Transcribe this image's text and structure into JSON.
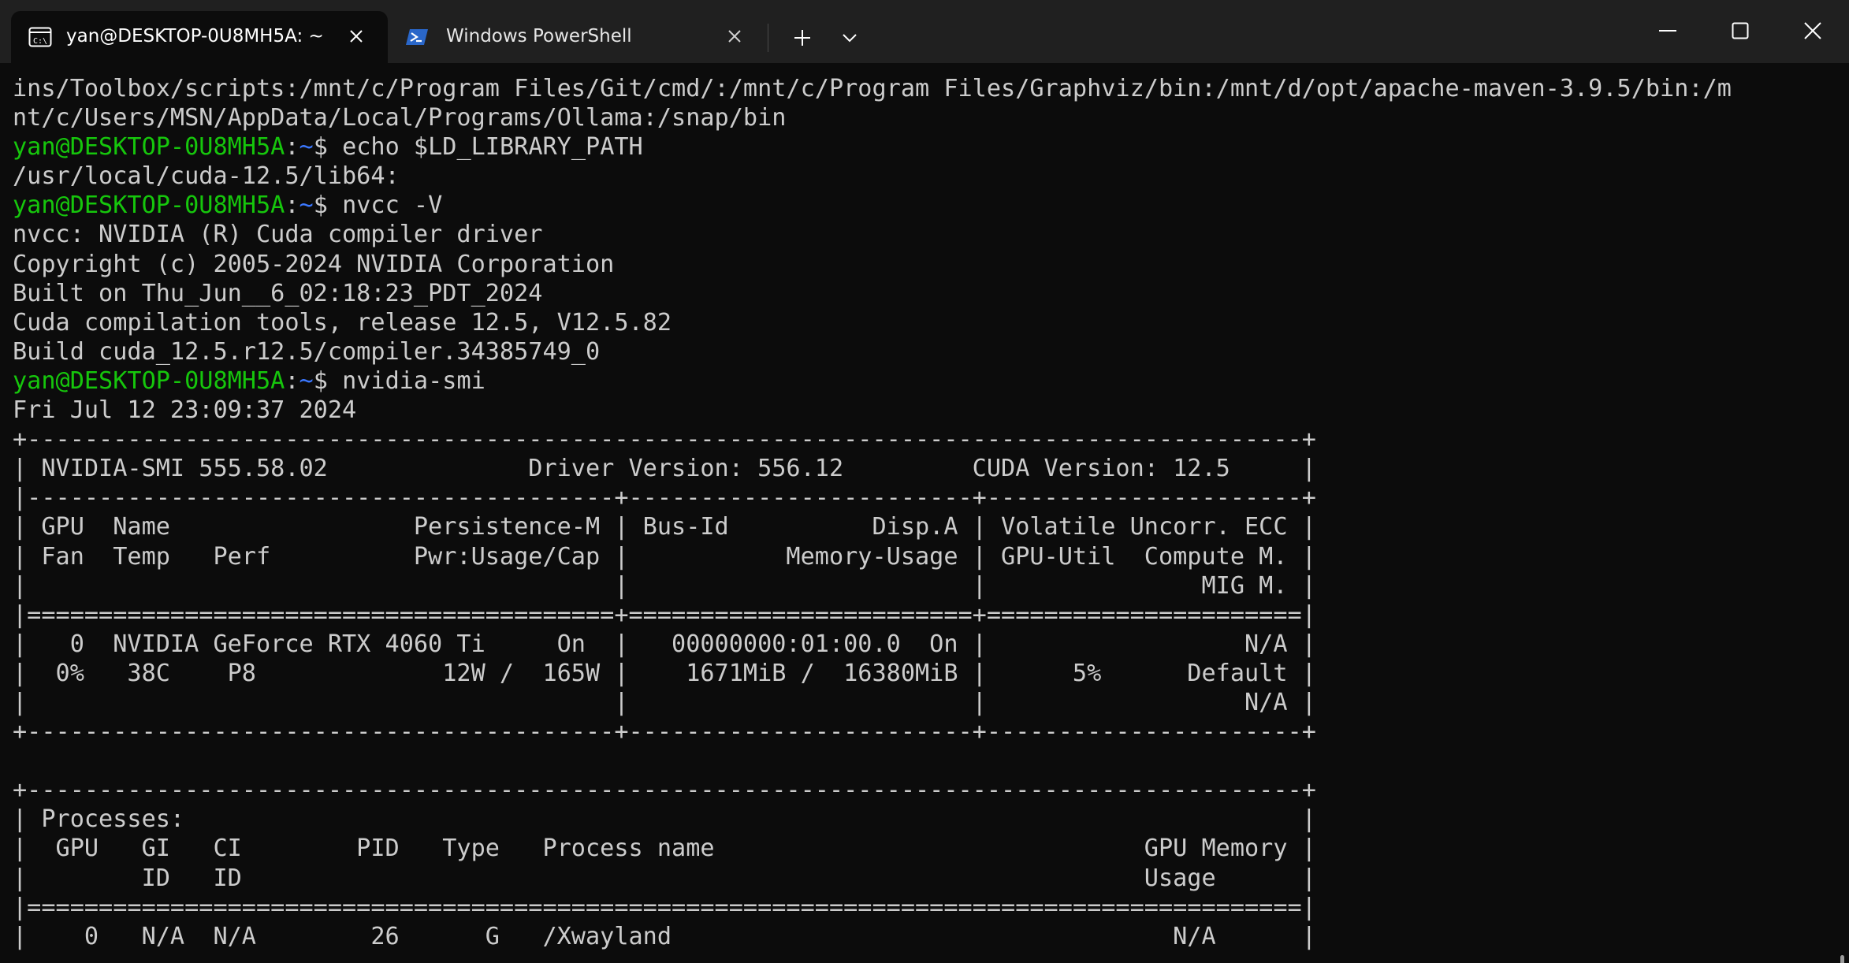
{
  "window": {
    "tabs": [
      {
        "label": "yan@DESKTOP-0U8MH5A: ~",
        "icon": "terminal-icon",
        "active": true
      },
      {
        "label": "Windows PowerShell",
        "icon": "powershell-icon",
        "active": false
      }
    ],
    "colors": {
      "titlebar": "#202020",
      "background": "#0c0c0c",
      "text": "#cccccc",
      "prompt_user": "#16c60c",
      "prompt_path": "#3b78ff"
    }
  },
  "prompt": {
    "user_host": "yan@DESKTOP-0U8MH5A",
    "sep": ":",
    "path": "~",
    "symbol": "$ "
  },
  "terminal": {
    "lines": [
      {
        "text": "ins/Toolbox/scripts:/mnt/c/Program Files/Git/cmd/:/mnt/c/Program Files/Graphviz/bin:/mnt/d/opt/apache-maven-3.9.5/bin:/m"
      },
      {
        "text": "nt/c/Users/MSN/AppData/Local/Programs/Ollama:/snap/bin"
      },
      {
        "cmd": "echo $LD_LIBRARY_PATH"
      },
      {
        "text": "/usr/local/cuda-12.5/lib64:"
      },
      {
        "cmd": "nvcc -V"
      },
      {
        "text": "nvcc: NVIDIA (R) Cuda compiler driver"
      },
      {
        "text": "Copyright (c) 2005-2024 NVIDIA Corporation"
      },
      {
        "text": "Built on Thu_Jun__6_02:18:23_PDT_2024"
      },
      {
        "text": "Cuda compilation tools, release 12.5, V12.5.82"
      },
      {
        "text": "Build cuda_12.5.r12.5/compiler.34385749_0"
      },
      {
        "cmd": "nvidia-smi"
      },
      {
        "text": "Fri Jul 12 23:09:37 2024"
      },
      {
        "text": "+-----------------------------------------------------------------------------------------+"
      },
      {
        "text": "| NVIDIA-SMI 555.58.02              Driver Version: 556.12         CUDA Version: 12.5     |"
      },
      {
        "text": "|-----------------------------------------+------------------------+----------------------+"
      },
      {
        "text": "| GPU  Name                 Persistence-M | Bus-Id          Disp.A | Volatile Uncorr. ECC |"
      },
      {
        "text": "| Fan  Temp   Perf          Pwr:Usage/Cap |           Memory-Usage | GPU-Util  Compute M. |"
      },
      {
        "text": "|                                         |                        |               MIG M. |"
      },
      {
        "text": "|=========================================+========================+======================|"
      },
      {
        "text": "|   0  NVIDIA GeForce RTX 4060 Ti     On  |   00000000:01:00.0  On |                  N/A |"
      },
      {
        "text": "|  0%   38C    P8             12W /  165W |    1671MiB /  16380MiB |      5%      Default |"
      },
      {
        "text": "|                                         |                        |                  N/A |"
      },
      {
        "text": "+-----------------------------------------+------------------------+----------------------+"
      },
      {
        "text": ""
      },
      {
        "text": "+-----------------------------------------------------------------------------------------+"
      },
      {
        "text": "| Processes:                                                                              |"
      },
      {
        "text": "|  GPU   GI   CI        PID   Type   Process name                              GPU Memory |"
      },
      {
        "text": "|        ID   ID                                                               Usage      |"
      },
      {
        "text": "|=========================================================================================|"
      },
      {
        "text": "|    0   N/A  N/A        26      G   /Xwayland                                   N/A      |"
      }
    ]
  }
}
